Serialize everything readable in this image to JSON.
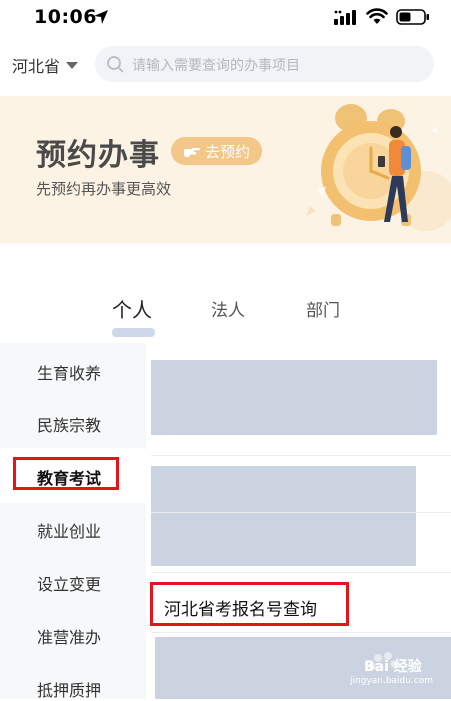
{
  "status_bar": {
    "time": "10:06"
  },
  "header": {
    "region": "河北省",
    "search_placeholder": "请输入需要查询的办事项目"
  },
  "banner": {
    "title": "预约办事",
    "button": "去预约",
    "subtitle": "先预约再办事更高效"
  },
  "tabs": [
    {
      "label": "个人",
      "active": true
    },
    {
      "label": "法人",
      "active": false
    },
    {
      "label": "部门",
      "active": false
    }
  ],
  "sidebar": {
    "items": [
      {
        "label": "生育收养"
      },
      {
        "label": "民族宗教"
      },
      {
        "label": "教育考试",
        "active": true
      },
      {
        "label": "就业创业"
      },
      {
        "label": "设立变更"
      },
      {
        "label": "准营准办"
      },
      {
        "label": "抵押质押"
      }
    ]
  },
  "results": {
    "highlighted_item": "河北省考报名号查询"
  },
  "watermark": {
    "brand": "Bai 经验",
    "url": "jingyan.baidu.com"
  },
  "colors": {
    "highlight": "#e5141b",
    "banner_bg": "#fdf3e4",
    "accent": "#f2c788"
  }
}
